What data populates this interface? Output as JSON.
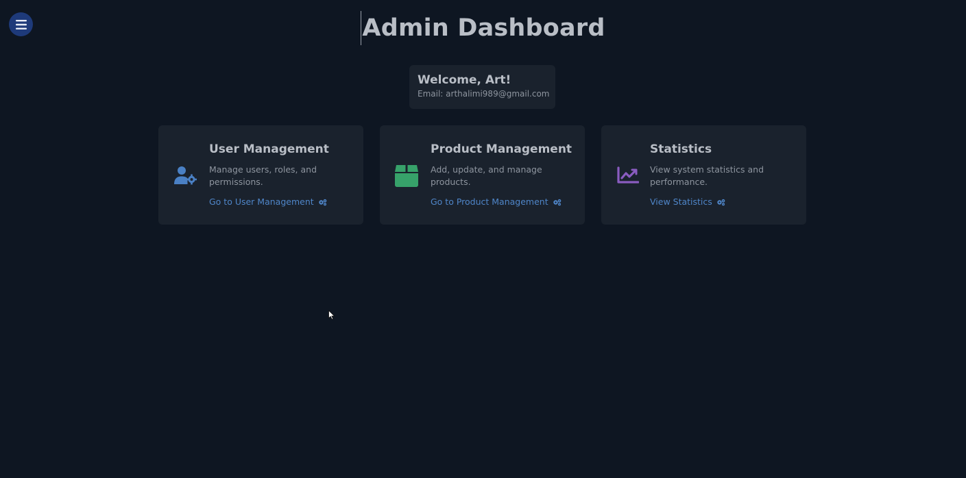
{
  "header": {
    "title": "Admin Dashboard",
    "menu_icon": "hamburger-icon"
  },
  "welcome": {
    "greeting": "Welcome, Art!",
    "email": "Email: arthalimi989@gmail.com"
  },
  "cards": [
    {
      "title": "User Management",
      "description": "Manage users, roles, and permissions.",
      "link_label": "Go to User Management",
      "icon": "user-gear-icon",
      "icon_color": "#4a80c4"
    },
    {
      "title": "Product Management",
      "description": "Add, update, and manage products.",
      "link_label": "Go to Product Management",
      "icon": "box-icon",
      "icon_color": "#37a26a"
    },
    {
      "title": "Statistics",
      "description": "View system statistics and performance.",
      "link_label": "View Statistics",
      "icon": "chart-line-icon",
      "icon_color": "#8a5cc0"
    }
  ],
  "colors": {
    "background": "#0e1622",
    "card": "#1a222d",
    "link": "#4f86c9",
    "menu_button": "#1e3a7a"
  }
}
